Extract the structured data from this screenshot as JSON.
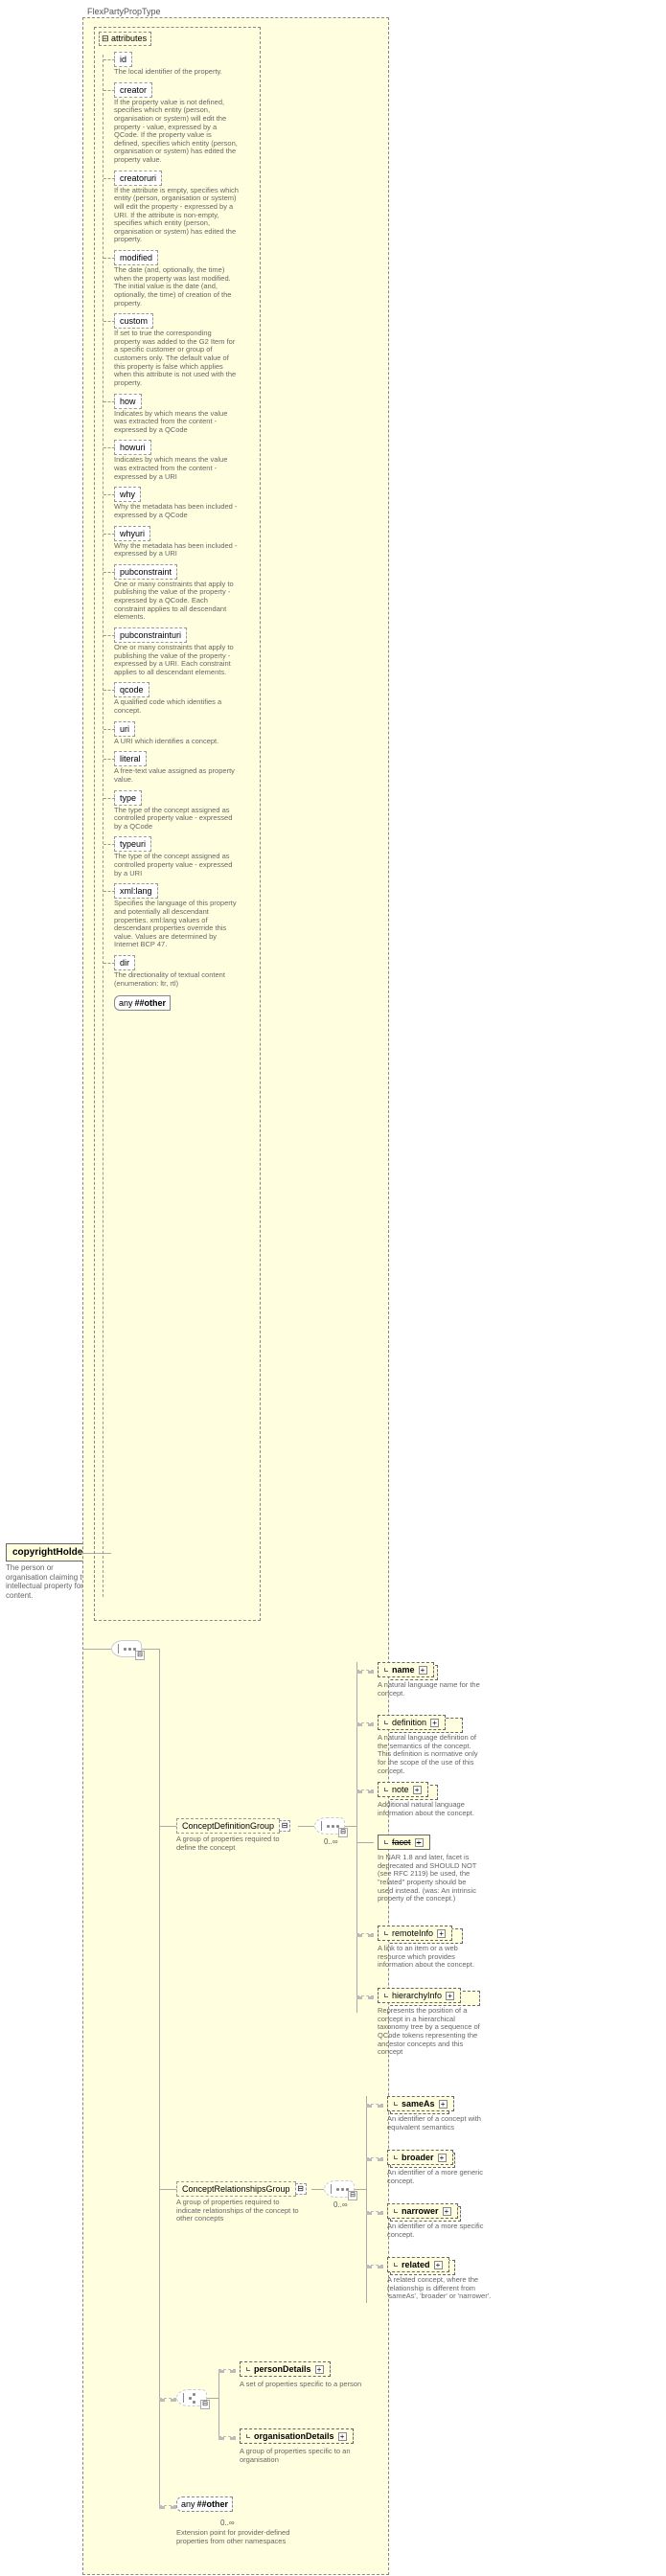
{
  "root": {
    "name": "copyrightHolder",
    "desc": "The person or organisation claiming the intellectual property for the content."
  },
  "typeLabel": "FlexPartyPropType",
  "attributesLabel": "attributes",
  "attrs": [
    {
      "name": "id",
      "desc": "The local identifier of the property."
    },
    {
      "name": "creator",
      "desc": "If the property value is not defined, specifies which entity (person, organisation or system) will edit the property - value, expressed by a QCode. If the property value is defined, specifies which entity (person, organisation or system) has edited the property value."
    },
    {
      "name": "creatoruri",
      "desc": "If the attribute is empty, specifies which entity (person, organisation or system) will edit the property - expressed by a URI. If the attribute is non-empty, specifies which entity (person, organisation or system) has edited the property."
    },
    {
      "name": "modified",
      "desc": "The date (and, optionally, the time) when the property was last modified. The initial value is the date (and, optionally, the time) of creation of the property."
    },
    {
      "name": "custom",
      "desc": "If set to true the corresponding property was added to the G2 Item for a specific customer or group of customers only. The default value of this property is false which applies when this attribute is not used with the property."
    },
    {
      "name": "how",
      "desc": "Indicates by which means the value was extracted from the content - expressed by a QCode"
    },
    {
      "name": "howuri",
      "desc": "Indicates by which means the value was extracted from the content - expressed by a URI"
    },
    {
      "name": "why",
      "desc": "Why the metadata has been included - expressed by a QCode"
    },
    {
      "name": "whyuri",
      "desc": "Why the metadata has been included - expressed by a URI"
    },
    {
      "name": "pubconstraint",
      "desc": "One or many constraints that apply to publishing the value of the property - expressed by a QCode. Each constraint applies to all descendant elements."
    },
    {
      "name": "pubconstrainturi",
      "desc": "One or many constraints that apply to publishing the value of the property - expressed by a URI. Each constraint applies to all descendant elements."
    },
    {
      "name": "qcode",
      "desc": "A qualified code which identifies a concept."
    },
    {
      "name": "uri",
      "desc": "A URI which identifies a concept."
    },
    {
      "name": "literal",
      "desc": "A free-text value assigned as property value."
    },
    {
      "name": "type",
      "desc": "The type of the concept assigned as controlled property value - expressed by a QCode"
    },
    {
      "name": "typeuri",
      "desc": "The type of the concept assigned as controlled property value - expressed by a URI"
    },
    {
      "name": "xml:lang",
      "desc": "Specifies the language of this property and potentially all descendant properties. xml:lang values of descendant properties override this value. Values are determined by Internet BCP 47."
    },
    {
      "name": "dir",
      "desc": "The directionality of textual content (enumeration: ltr, rtl)"
    }
  ],
  "anyOther": "##other",
  "anyLabel": "any",
  "groups": {
    "conceptDef": {
      "name": "ConceptDefinitionGroup",
      "desc": "A group of properties required to define the concept"
    },
    "conceptRel": {
      "name": "ConceptRelationshipsGroup",
      "desc": "A group of properties required to indicate relationships of the concept to other concepts"
    }
  },
  "defChildren": [
    {
      "name": "name",
      "desc": "A natural language name for the concept."
    },
    {
      "name": "definition",
      "desc": "A natural language definition of the semantics of the concept. This definition is normative only for the scope of the use of this concept."
    },
    {
      "name": "note",
      "desc": "Additional natural language information about the concept."
    },
    {
      "name": "facet",
      "desc": "In NAR 1.8 and later, facet is deprecated and SHOULD NOT (see RFC 2119) be used, the \"related\" property should be used instead. (was: An intrinsic property of the concept.)",
      "deprecated": true
    },
    {
      "name": "remoteInfo",
      "desc": "A link to an item or a web resource which provides information about the concept."
    },
    {
      "name": "hierarchyInfo",
      "desc": "Represents the position of a concept in a hierarchical taxonomy tree by a sequence of QCode tokens representing the ancestor concepts and this concept"
    }
  ],
  "relChildren": [
    {
      "name": "sameAs",
      "desc": "An identifier of a concept with equivalent semantics"
    },
    {
      "name": "broader",
      "desc": "An identifier of a more generic concept."
    },
    {
      "name": "narrower",
      "desc": "An identifier of a more specific concept."
    },
    {
      "name": "related",
      "desc": "A related concept, where the relationship is different from 'sameAs', 'broader' or 'narrower'."
    }
  ],
  "detailChildren": [
    {
      "name": "personDetails",
      "desc": "A set of properties specific to a person"
    },
    {
      "name": "organisationDetails",
      "desc": "A group of properties specific to an organisation"
    }
  ],
  "extensionDesc": "Extension point for provider-defined properties from other namespaces",
  "occurrence": "0..∞"
}
